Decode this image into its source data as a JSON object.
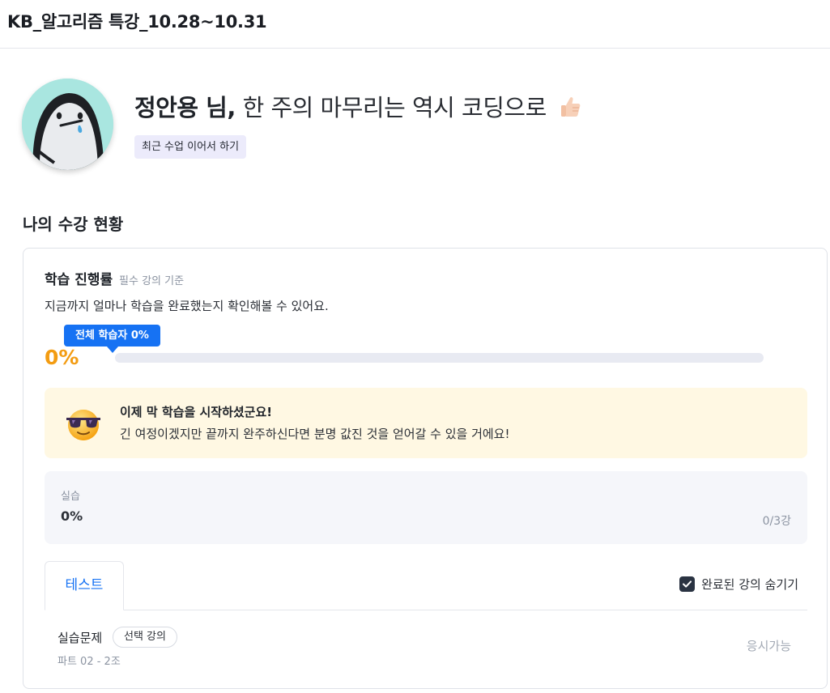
{
  "header": {
    "course_title": "KB_알고리즘 특강_10.28~10.31"
  },
  "profile": {
    "name": "정안용 님,",
    "message": "한 주의 마무리는 역시 코딩으로",
    "emoji": "thumbs-up-icon",
    "recent_button": "최근 수업 이어서 하기",
    "avatar_bg": "#a9e6e0"
  },
  "section": {
    "title": "나의 수강 현황"
  },
  "progress": {
    "title": "학습 진행률",
    "subtitle": "필수 강의 기준",
    "description": "지금까지 얼마나 학습을 완료했는지 확인해볼 수 있어요.",
    "tooltip_prefix": "전체 학습자",
    "tooltip_value": "0%",
    "percent_label": "0%",
    "fraction": 0,
    "accent_color": "#1672f3",
    "percent_color": "#f39c12"
  },
  "notice": {
    "emoji": "sunglasses-face-icon",
    "title": "이제 막 학습을 시작하셨군요!",
    "text": "긴 여정이겠지만 끝까지 완주하신다면 분명 값진 것을 얻어갈 수 있을 거에요!"
  },
  "practice": {
    "label": "실습",
    "value": "0%",
    "count": "0/3강"
  },
  "tabs": [
    {
      "label": "테스트",
      "active": true
    }
  ],
  "hide_completed": {
    "label": "완료된 강의 숨기기",
    "checked": true
  },
  "lessons": [
    {
      "name": "실습문제",
      "badge": "선택 강의",
      "sub": "파트 02 - 2조",
      "status": "응시가능"
    }
  ]
}
